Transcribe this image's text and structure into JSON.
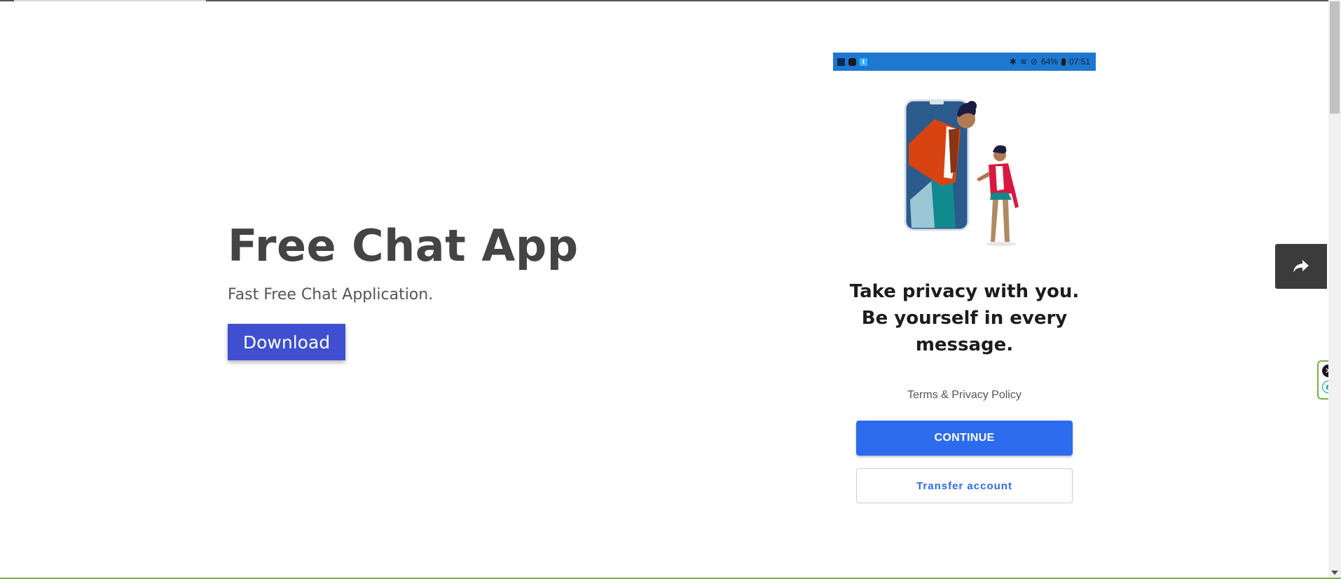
{
  "hero": {
    "title": "Free Chat App",
    "subtitle": "Fast Free Chat Application.",
    "download_label": "Download"
  },
  "phone": {
    "status_bar": {
      "battery": "64%",
      "time": "07:51"
    },
    "heading_lines": [
      "Take privacy with you.",
      "Be yourself in every",
      "message."
    ],
    "terms_label": "Terms & Privacy Policy",
    "continue_label": "CONTINUE",
    "transfer_label": "Transfer account"
  },
  "colors": {
    "download": "#3f4fcf",
    "continue": "#2c6bed",
    "status_bar": "#1e78d0",
    "share": "#3b3b3b"
  },
  "icons": {
    "share": "share-arrow-icon",
    "edge_close": "close-icon",
    "edge_logo": "e-logo-icon"
  },
  "edge_widget": {
    "close_glyph": "✕",
    "logo_glyph": "e"
  }
}
